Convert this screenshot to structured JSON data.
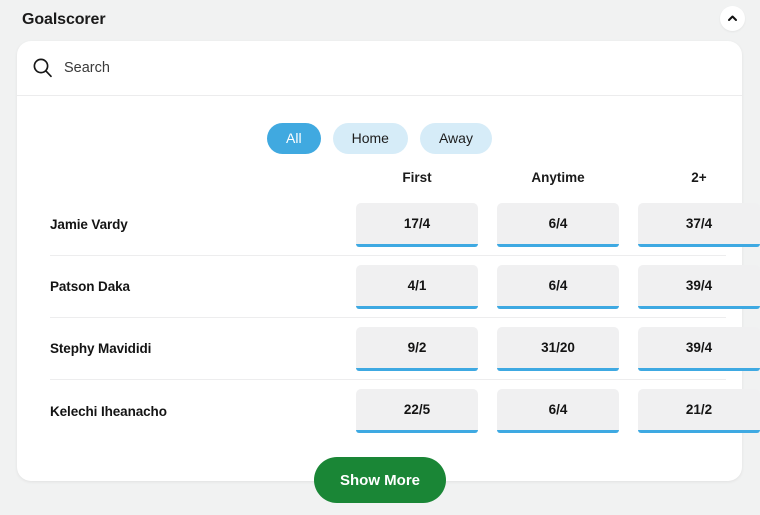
{
  "header": {
    "title": "Goalscorer",
    "collapse_icon": "chevron-up-icon"
  },
  "search": {
    "icon": "search-icon",
    "placeholder": "Search",
    "value": ""
  },
  "filters": {
    "options": [
      {
        "label": "All",
        "active": true
      },
      {
        "label": "Home",
        "active": false
      },
      {
        "label": "Away",
        "active": false
      }
    ]
  },
  "table": {
    "columns": [
      "First",
      "Anytime",
      "2+"
    ],
    "rows": [
      {
        "player": "Jamie Vardy",
        "odds": [
          "17/4",
          "6/4",
          "37/4"
        ]
      },
      {
        "player": "Patson Daka",
        "odds": [
          "4/1",
          "6/4",
          "39/4"
        ]
      },
      {
        "player": "Stephy Mavididi",
        "odds": [
          "9/2",
          "31/20",
          "39/4"
        ]
      },
      {
        "player": "Kelechi Iheanacho",
        "odds": [
          "22/5",
          "6/4",
          "21/2"
        ]
      }
    ]
  },
  "footer": {
    "show_more_label": "Show More"
  },
  "colors": {
    "accent_blue": "#40a9e0",
    "pill_inactive": "#d6ecf8",
    "odds_bg": "#f0f0f1",
    "odds_underline": "#3ea9e2",
    "green": "#1a8636",
    "page_bg": "#f1f2f2"
  }
}
